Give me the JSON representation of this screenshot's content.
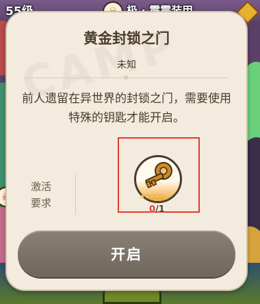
{
  "hud": {
    "level_text": "55级",
    "equip_text": "极 · 霹雳装甲"
  },
  "dialog": {
    "title": "黄金封锁之门",
    "subtitle": "未知",
    "description": "前人遗留在异世界的封锁之门，需要使用特殊的钥匙才能开启。",
    "requirement_label": "激活要求",
    "item": {
      "name_icon": "golden-key-icon",
      "stars": "★★★★★",
      "current": "0",
      "separator_total": "/1"
    },
    "open_button": "开启"
  },
  "colors": {
    "panel": "#f3ebdd",
    "text": "#4a3b2c",
    "highlight_box": "#e23a2e",
    "button": "#7d746a"
  }
}
